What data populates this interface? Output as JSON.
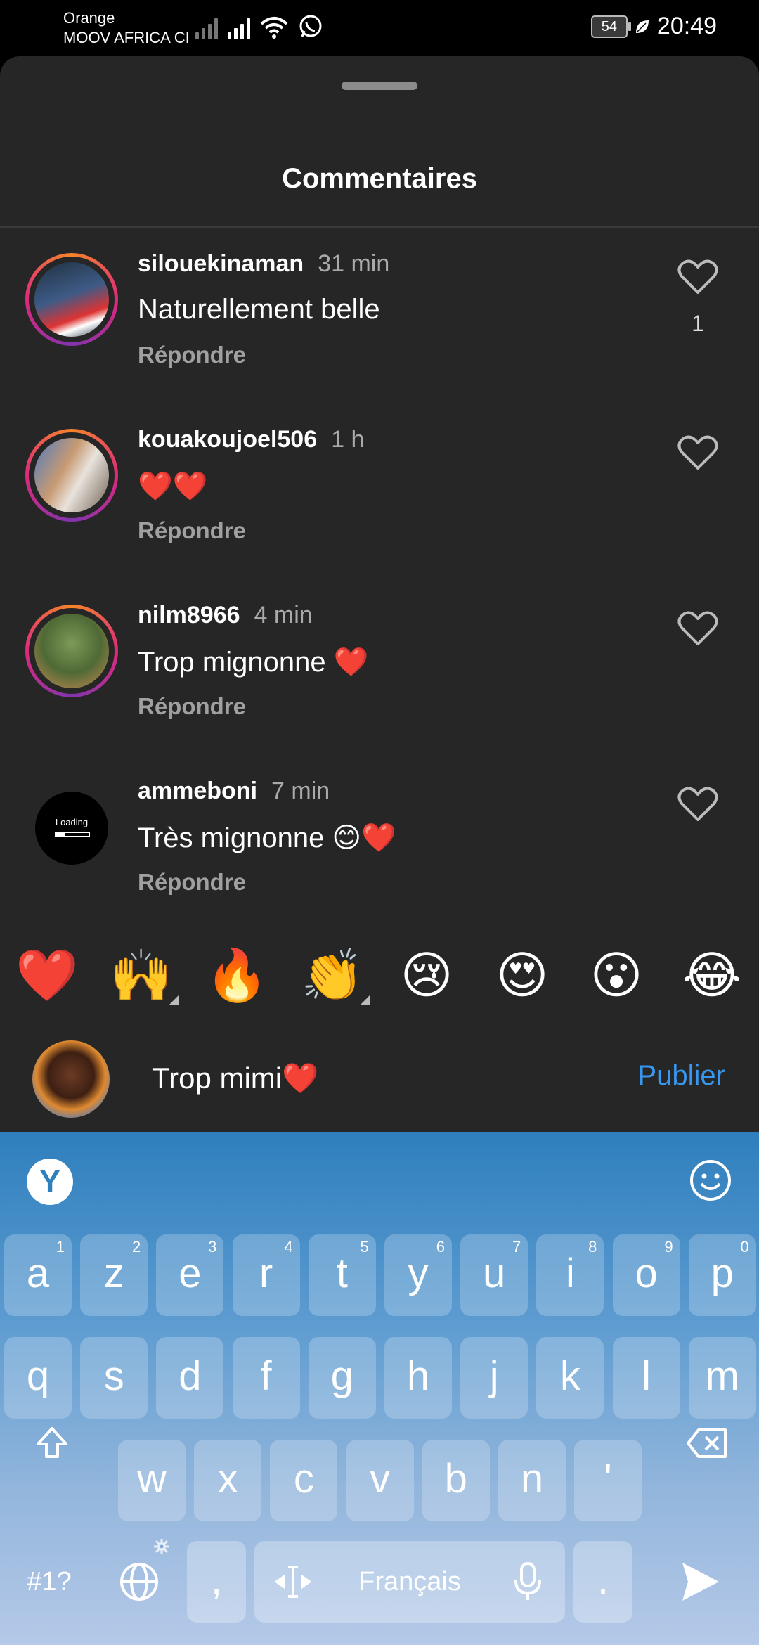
{
  "status_bar": {
    "carrier_1": "Orange",
    "carrier_2": "MOOV AFRICA CI",
    "battery": "54",
    "time": "20:49"
  },
  "sheet": {
    "title": "Commentaires"
  },
  "comments": [
    {
      "username": "silouekinaman",
      "time": "31 min",
      "text": "Naturellement belle",
      "reply": "Répondre",
      "likes": "1"
    },
    {
      "username": "kouakoujoel506",
      "time": "1 h",
      "text": "❤️❤️",
      "reply": "Répondre",
      "likes": ""
    },
    {
      "username": "nilm8966",
      "time": "4 min",
      "text": "Trop mignonne ❤️",
      "reply": "Répondre",
      "likes": ""
    },
    {
      "username": "ammeboni",
      "time": "7 min",
      "text": "Très mignonne 😊❤️",
      "reply": "Répondre",
      "likes": "",
      "avatar_text": "Loading"
    }
  ],
  "emoji_bar": [
    "❤️",
    "🙌",
    "🔥",
    "👏",
    "😢",
    "😍",
    "😮",
    "😂"
  ],
  "composer": {
    "value": "Trop mimi❤️",
    "publish_label": "Publier"
  },
  "keyboard": {
    "row1": [
      [
        "a",
        "1"
      ],
      [
        "z",
        "2"
      ],
      [
        "e",
        "3"
      ],
      [
        "r",
        "4"
      ],
      [
        "t",
        "5"
      ],
      [
        "y",
        "6"
      ],
      [
        "u",
        "7"
      ],
      [
        "i",
        "8"
      ],
      [
        "o",
        "9"
      ],
      [
        "p",
        "0"
      ]
    ],
    "row2": [
      "q",
      "s",
      "d",
      "f",
      "g",
      "h",
      "j",
      "k",
      "l",
      "m"
    ],
    "row3": [
      "w",
      "x",
      "c",
      "v",
      "b",
      "n",
      "'"
    ],
    "symbols_label": "#1?",
    "comma_label": ",",
    "space_label": "Français",
    "period_label": ".",
    "logo_letter": "Y"
  },
  "colors": {
    "accent_blue": "#3897f0",
    "heart_red": "#e5202a",
    "sheet_bg": "#262626"
  }
}
